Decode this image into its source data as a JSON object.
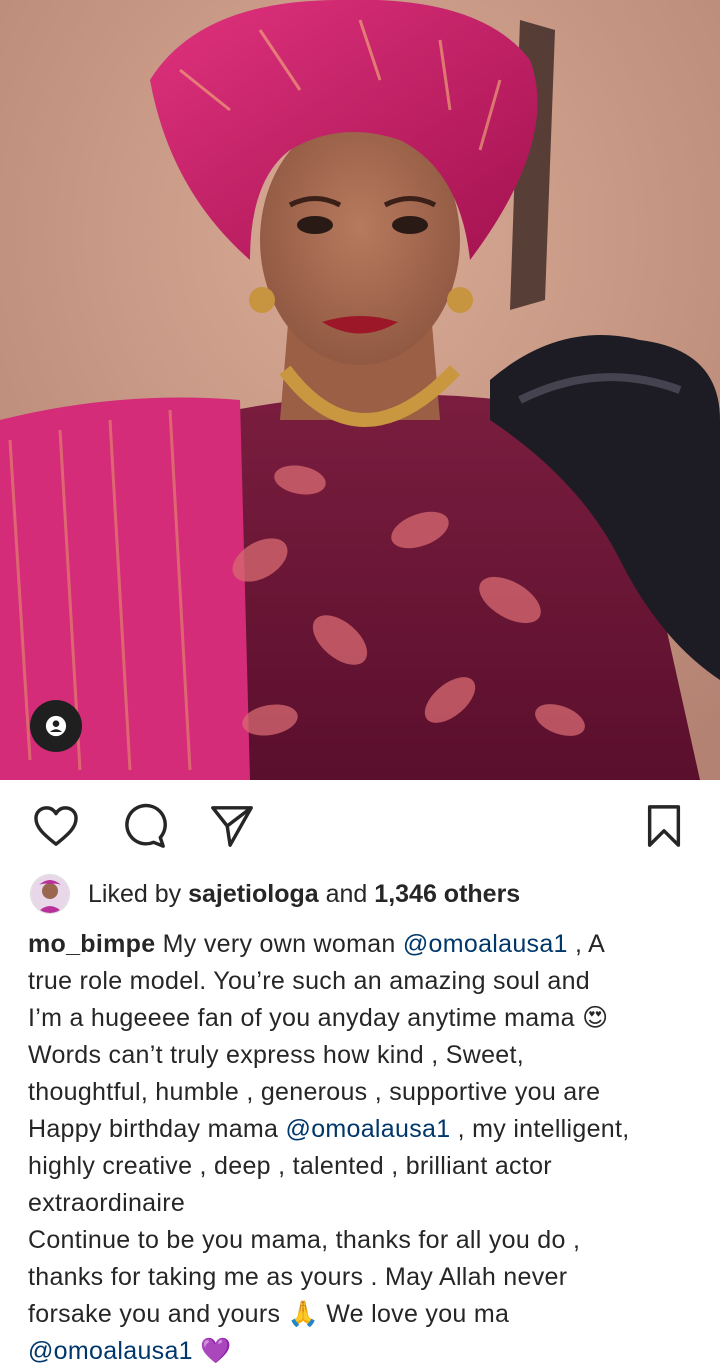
{
  "post": {
    "photo": {
      "description_icon": "tagged-user-icon"
    },
    "actions": {
      "like": "heart-icon",
      "comment": "comment-icon",
      "share": "send-icon",
      "save": "bookmark-icon"
    },
    "likes": {
      "prefix": "Liked by",
      "user": "sajetiologa",
      "joiner": "and",
      "others": "1,346 others"
    },
    "caption": {
      "username": "mo_bimpe",
      "lines": [
        {
          "before": " My very own woman ",
          "mention": "@omoalausa1",
          "after": " , A"
        },
        {
          "before": "true role model. You’re such an amazing soul and",
          "mention": "",
          "after": ""
        },
        {
          "before": "I’m a hugeeee fan of you anyday anytime mama 😍",
          "mention": "",
          "after": ""
        },
        {
          "before": "Words can’t truly express how kind , Sweet,",
          "mention": "",
          "after": ""
        },
        {
          "before": "thoughtful, humble , generous , supportive you are",
          "mention": "",
          "after": ""
        },
        {
          "before": "Happy birthday mama ",
          "mention": "@omoalausa1",
          "after": " , my intelligent,"
        },
        {
          "before": "highly creative , deep , talented , brilliant actor",
          "mention": "",
          "after": ""
        },
        {
          "before": "extraordinaire",
          "mention": "",
          "after": ""
        },
        {
          "before": "Continue to be you mama, thanks for all you do ,",
          "mention": "",
          "after": ""
        },
        {
          "before": "thanks for taking me as yours . May Allah never",
          "mention": "",
          "after": ""
        },
        {
          "before": "forsake you and yours 🙏 We love you ma",
          "mention": "",
          "after": ""
        },
        {
          "before": "",
          "mention": "@omoalausa1",
          "after": " 💜"
        }
      ]
    },
    "colors": {
      "mention": "#00376b",
      "text": "#262626"
    }
  }
}
